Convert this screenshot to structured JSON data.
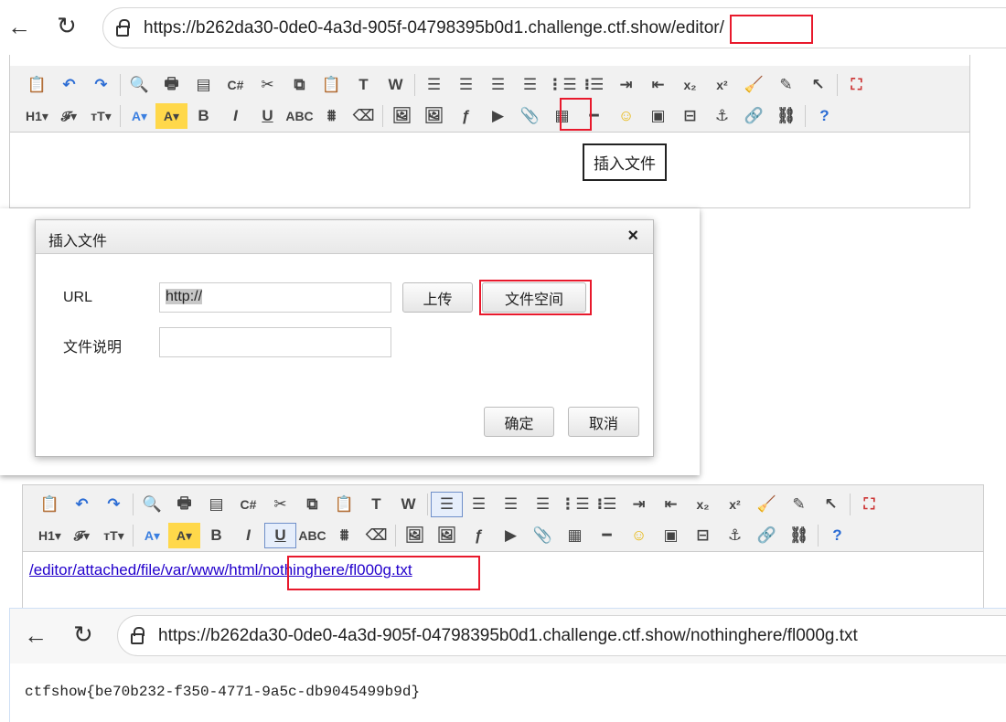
{
  "browser1": {
    "url": "https://b262da30-0de0-4a3d-905f-04798395b0d1.challenge.ctf.show/editor/"
  },
  "toolbar": {
    "row1": [
      "paste-plain-icon",
      "undo-icon",
      "redo-icon",
      "|",
      "preview-icon",
      "print-icon",
      "template-icon",
      "code-icon",
      "cut-icon",
      "copy-icon",
      "paste-icon",
      "paste-text-icon",
      "paste-word-icon",
      "|",
      "align-left-icon",
      "align-center-icon",
      "align-right-icon",
      "align-justify-icon",
      "ordered-list-icon",
      "unordered-list-icon",
      "indent-icon",
      "outdent-icon",
      "subscript-icon",
      "superscript-icon",
      "clear-html-icon",
      "quick-format-icon",
      "select-all-icon",
      "|",
      "fullscreen-icon"
    ],
    "row2": [
      "heading-icon",
      "font-family-icon",
      "font-size-icon",
      "|",
      "fore-color-icon",
      "hilite-color-icon",
      "bold-icon",
      "italic-icon",
      "underline-icon",
      "strikethrough-icon",
      "line-height-icon",
      "remove-format-icon",
      "|",
      "image-icon",
      "multi-image-icon",
      "flash-icon",
      "media-icon",
      "insert-file-icon",
      "table-icon",
      "hr-icon",
      "emoticon-icon",
      "map-icon",
      "pagebreak-icon",
      "anchor-icon",
      "link-icon",
      "unlink-icon",
      "|",
      "about-icon"
    ]
  },
  "tooltip": "插入文件",
  "dialog": {
    "title": "插入文件",
    "url_label": "URL",
    "url_value": "http://",
    "upload_button": "上传",
    "file_space_button": "文件空间",
    "desc_label": "文件说明",
    "desc_value": "",
    "ok_button": "确定",
    "cancel_button": "取消"
  },
  "editor2": {
    "link_text": "/editor/attached/file/var/www/html/nothinghere/fl000g.txt"
  },
  "browser2": {
    "url": "https://b262da30-0de0-4a3d-905f-04798395b0d1.challenge.ctf.show/nothinghere/fl000g.txt",
    "content": "ctfshow{be70b232-f350-4771-9a5c-db9045499b9d}"
  },
  "colors": {
    "highlight": "#e8192c",
    "link": "#2200cc"
  }
}
